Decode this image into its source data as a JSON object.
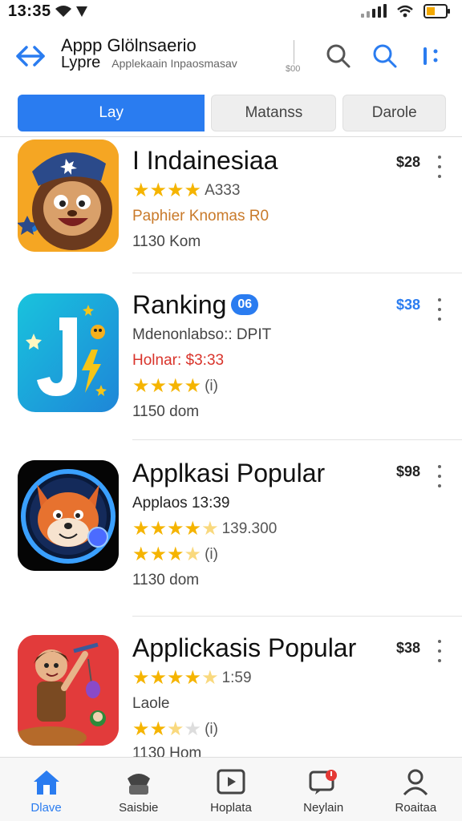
{
  "status_bar": {
    "time": "13:35"
  },
  "header": {
    "title_line1": "Appp Glölnsaerio",
    "title_line2": "Lypre",
    "subtitle": "Applekaain Inpaosmasav",
    "badge": "$00"
  },
  "tabs": [
    {
      "label": "Lay",
      "active": true
    },
    {
      "label": "Matanss",
      "active": false
    },
    {
      "label": "Darole",
      "active": false
    }
  ],
  "apps": [
    {
      "name": "I Indainesiaa",
      "price": "$28",
      "line1": "Paphier Knomas R0",
      "rating_text": "A333",
      "stars": 4,
      "size": "1130 Kom",
      "icon": "pirate-monkey-icon"
    },
    {
      "name": "Ranking",
      "badge": "06",
      "price": "$38",
      "line1": "Mdenonlabso:: DPIT",
      "line2": "Holnar: $3:33",
      "rating_text": "(i)",
      "stars": 4,
      "size": "1150 dom",
      "icon": "letter-j-icon"
    },
    {
      "name": "Applkasi Popular",
      "price": "$98",
      "line1": "Applaos 13:39",
      "rating_text": "139.300",
      "stars": 4.5,
      "rating2_text": "(i)",
      "stars2": 3.5,
      "size": "1130 dom",
      "icon": "fox-icon"
    },
    {
      "name": "Applickasis Popular",
      "price": "$38",
      "rating_text": "1:59",
      "stars": 4.5,
      "line1": "Laole",
      "rating2_text": "(i)",
      "stars2": 2.5,
      "size": "1130 Hom",
      "icon": "adventurer-icon"
    }
  ],
  "bottom_nav": [
    {
      "label": "Dlave",
      "icon": "home-icon",
      "active": true
    },
    {
      "label": "Saisbie",
      "icon": "games-icon",
      "active": false
    },
    {
      "label": "Hoplata",
      "icon": "video-icon",
      "active": false
    },
    {
      "label": "Neylain",
      "icon": "notifications-icon",
      "active": false
    },
    {
      "label": "Roaitaa",
      "icon": "profile-icon",
      "active": false
    }
  ]
}
